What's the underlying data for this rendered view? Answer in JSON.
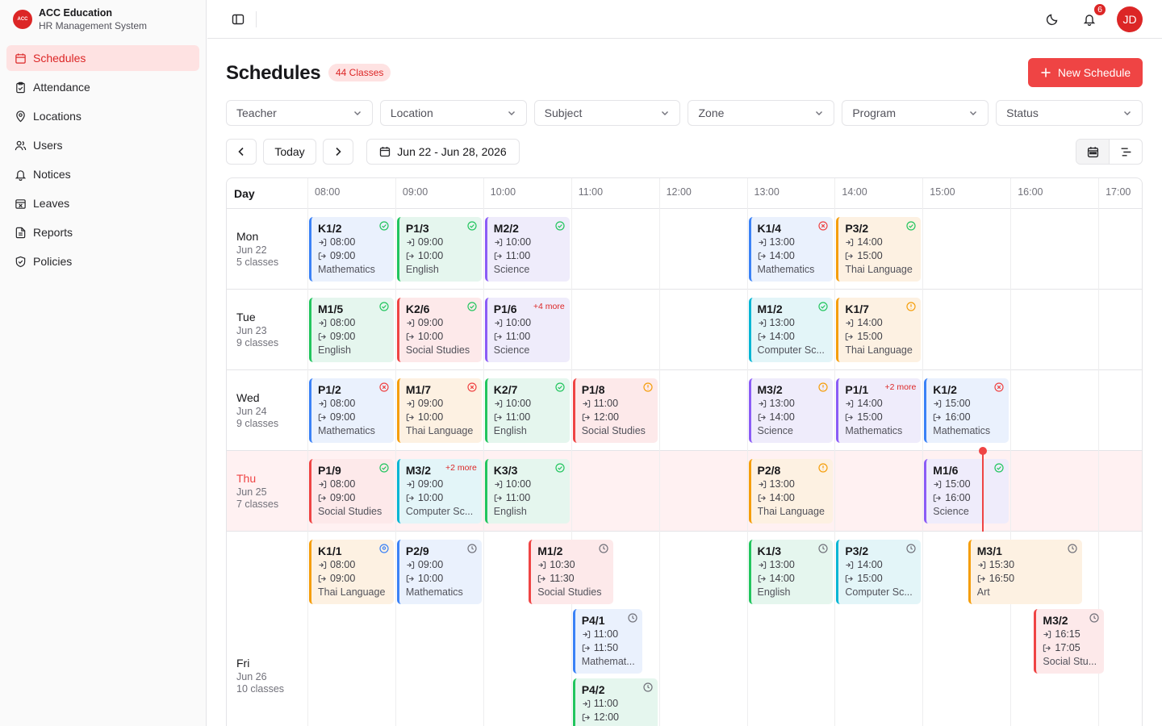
{
  "brand": {
    "logo": "ACC",
    "name": "ACC Education",
    "subtitle": "HR Management System"
  },
  "nav": [
    {
      "label": "Schedules",
      "icon": "calendar-icon",
      "active": true
    },
    {
      "label": "Attendance",
      "icon": "clipboard-icon"
    },
    {
      "label": "Locations",
      "icon": "map-pin-icon"
    },
    {
      "label": "Users",
      "icon": "users-icon"
    },
    {
      "label": "Notices",
      "icon": "bell-icon"
    },
    {
      "label": "Leaves",
      "icon": "calendar-x-icon"
    },
    {
      "label": "Reports",
      "icon": "file-text-icon"
    },
    {
      "label": "Policies",
      "icon": "shield-check-icon"
    }
  ],
  "topbar": {
    "notification_count": "6",
    "avatar_initials": "JD"
  },
  "header": {
    "title": "Schedules",
    "count_badge": "44 Classes",
    "new_button": "New Schedule"
  },
  "filters": [
    "Teacher",
    "Location",
    "Subject",
    "Zone",
    "Program",
    "Status"
  ],
  "date_nav": {
    "today_label": "Today",
    "range": "Jun 22 - Jun 28, 2026"
  },
  "grid": {
    "day_header": "Day",
    "hours": [
      "08:00",
      "09:00",
      "10:00",
      "11:00",
      "12:00",
      "13:00",
      "14:00",
      "15:00",
      "16:00",
      "17:00"
    ],
    "days": [
      {
        "day": "Mon",
        "date": "Jun 22",
        "count": "5 classes",
        "today": false
      },
      {
        "day": "Tue",
        "date": "Jun 23",
        "count": "9 classes",
        "today": false
      },
      {
        "day": "Wed",
        "date": "Jun 24",
        "count": "9 classes",
        "today": false
      },
      {
        "day": "Thu",
        "date": "Jun 25",
        "count": "7 classes",
        "today": true
      },
      {
        "day": "Fri",
        "date": "Jun 26",
        "count": "10 classes",
        "today": false
      }
    ],
    "classes": [
      {
        "day": 0,
        "code": "K1/2",
        "start": "08:00",
        "end": "09:00",
        "subject": "Mathematics",
        "color": "blue",
        "status": "check"
      },
      {
        "day": 0,
        "code": "P1/3",
        "start": "09:00",
        "end": "10:00",
        "subject": "English",
        "color": "green",
        "status": "check"
      },
      {
        "day": 0,
        "code": "M2/2",
        "start": "10:00",
        "end": "11:00",
        "subject": "Science",
        "color": "purple",
        "status": "check"
      },
      {
        "day": 0,
        "code": "K1/4",
        "start": "13:00",
        "end": "14:00",
        "subject": "Mathematics",
        "color": "blue",
        "status": "x"
      },
      {
        "day": 0,
        "code": "P3/2",
        "start": "14:00",
        "end": "15:00",
        "subject": "Thai Language",
        "color": "orange",
        "status": "check"
      },
      {
        "day": 1,
        "code": "M1/5",
        "start": "08:00",
        "end": "09:00",
        "subject": "English",
        "color": "green",
        "status": "check"
      },
      {
        "day": 1,
        "code": "K2/6",
        "start": "09:00",
        "end": "10:00",
        "subject": "Social Studies",
        "color": "red",
        "status": "check"
      },
      {
        "day": 1,
        "code": "P1/6",
        "start": "10:00",
        "end": "11:00",
        "subject": "Science",
        "color": "purple",
        "more": "+4 more"
      },
      {
        "day": 1,
        "code": "M1/2",
        "start": "13:00",
        "end": "14:00",
        "subject": "Computer Sc...",
        "color": "teal",
        "status": "check"
      },
      {
        "day": 1,
        "code": "K1/7",
        "start": "14:00",
        "end": "15:00",
        "subject": "Thai Language",
        "color": "orange",
        "status": "warn"
      },
      {
        "day": 2,
        "code": "P1/2",
        "start": "08:00",
        "end": "09:00",
        "subject": "Mathematics",
        "color": "blue",
        "status": "x"
      },
      {
        "day": 2,
        "code": "M1/7",
        "start": "09:00",
        "end": "10:00",
        "subject": "Thai Language",
        "color": "orange",
        "status": "x"
      },
      {
        "day": 2,
        "code": "K2/7",
        "start": "10:00",
        "end": "11:00",
        "subject": "English",
        "color": "green",
        "status": "check"
      },
      {
        "day": 2,
        "code": "P1/8",
        "start": "11:00",
        "end": "12:00",
        "subject": "Social Studies",
        "color": "red",
        "status": "warn"
      },
      {
        "day": 2,
        "code": "M3/2",
        "start": "13:00",
        "end": "14:00",
        "subject": "Science",
        "color": "purple",
        "status": "warn"
      },
      {
        "day": 2,
        "code": "P1/1",
        "start": "14:00",
        "end": "15:00",
        "subject": "Mathematics",
        "color": "purple",
        "more": "+2 more"
      },
      {
        "day": 2,
        "code": "K1/2",
        "start": "15:00",
        "end": "16:00",
        "subject": "Mathematics",
        "color": "blue",
        "status": "x"
      },
      {
        "day": 3,
        "code": "P1/9",
        "start": "08:00",
        "end": "09:00",
        "subject": "Social Studies",
        "color": "red",
        "status": "check"
      },
      {
        "day": 3,
        "code": "M3/2",
        "start": "09:00",
        "end": "10:00",
        "subject": "Computer Sc...",
        "color": "teal",
        "more": "+2 more"
      },
      {
        "day": 3,
        "code": "K3/3",
        "start": "10:00",
        "end": "11:00",
        "subject": "English",
        "color": "green",
        "status": "check"
      },
      {
        "day": 3,
        "code": "P2/8",
        "start": "13:00",
        "end": "14:00",
        "subject": "Thai Language",
        "color": "orange",
        "status": "warn"
      },
      {
        "day": 3,
        "code": "M1/6",
        "start": "15:00",
        "end": "16:00",
        "subject": "Science",
        "color": "purple",
        "status": "check"
      },
      {
        "day": 4,
        "code": "K1/1",
        "start": "08:00",
        "end": "09:00",
        "subject": "Thai Language",
        "color": "orange",
        "status": "pin"
      },
      {
        "day": 4,
        "code": "P2/9",
        "start": "09:00",
        "end": "10:00",
        "subject": "Mathematics",
        "color": "blue",
        "status": "clock"
      },
      {
        "day": 4,
        "code": "M1/2",
        "start": "10:30",
        "end": "11:30",
        "subject": "Social Studies",
        "color": "red",
        "status": "clock"
      },
      {
        "day": 4,
        "code": "P4/1",
        "start": "11:00",
        "end": "11:50",
        "subject": "Mathemat...",
        "color": "blue",
        "status": "clock",
        "lane": 1
      },
      {
        "day": 4,
        "code": "P4/2",
        "start": "11:00",
        "end": "12:00",
        "subject": "",
        "color": "green",
        "status": "clock",
        "lane": 2
      },
      {
        "day": 4,
        "code": "K1/3",
        "start": "13:00",
        "end": "14:00",
        "subject": "English",
        "color": "green",
        "status": "clock"
      },
      {
        "day": 4,
        "code": "P3/2",
        "start": "14:00",
        "end": "15:00",
        "subject": "Computer Sc...",
        "color": "teal",
        "status": "clock"
      },
      {
        "day": 4,
        "code": "M3/1",
        "start": "15:30",
        "end": "16:50",
        "subject": "Art",
        "color": "orange",
        "status": "clock"
      },
      {
        "day": 4,
        "code": "M3/2",
        "start": "16:15",
        "end": "17:05",
        "subject": "Social Stu...",
        "color": "red",
        "status": "clock",
        "lane": 1
      }
    ]
  }
}
